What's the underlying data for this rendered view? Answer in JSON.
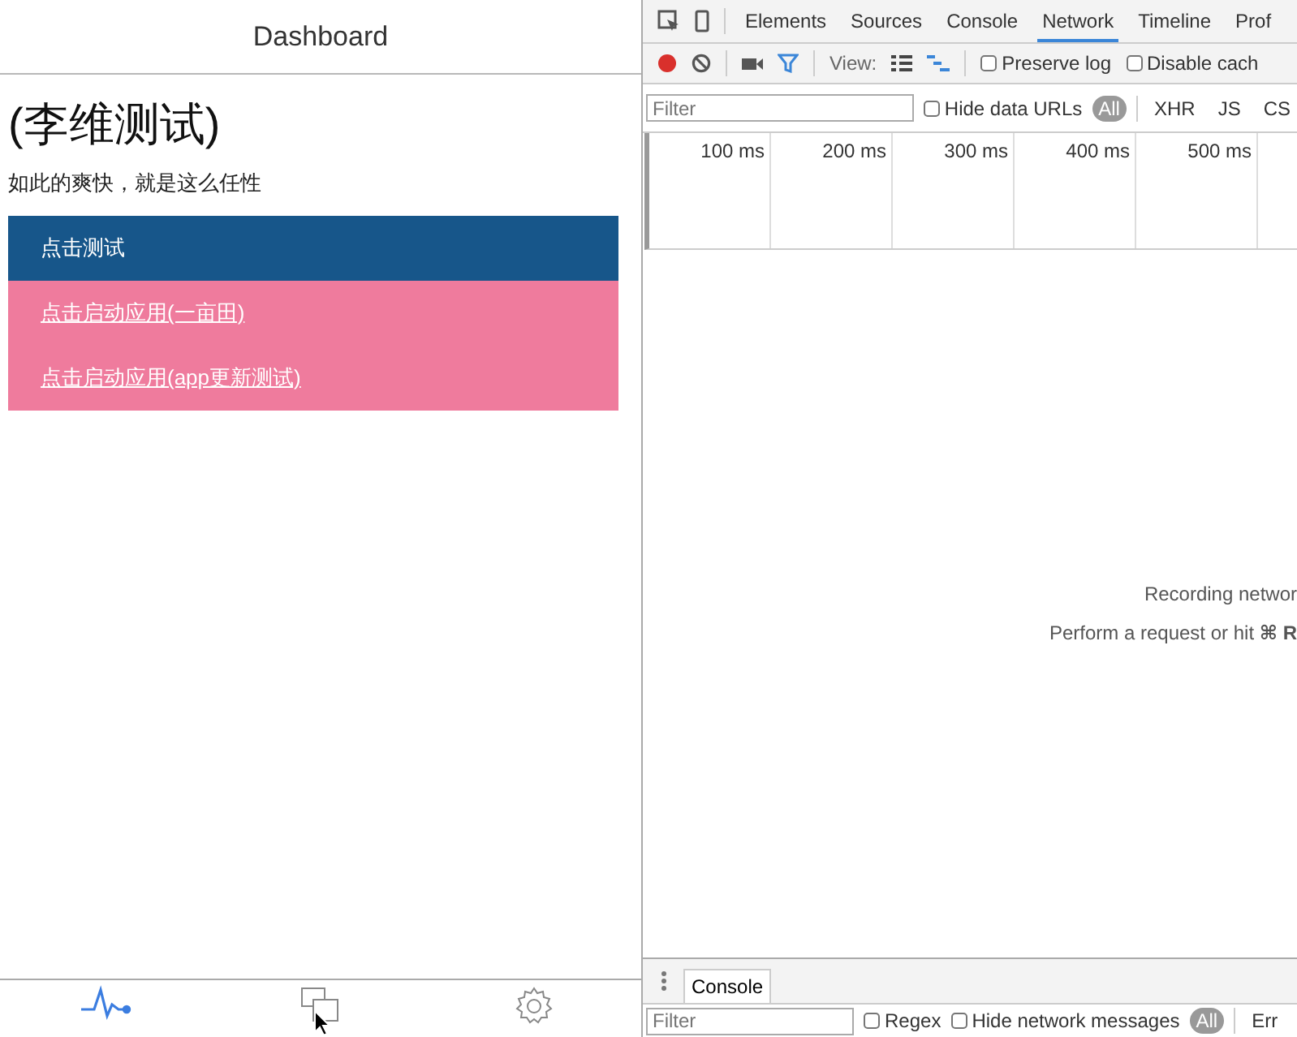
{
  "app": {
    "title": "Dashboard",
    "heading": "(李维测试)",
    "subtitle": "如此的爽快，就是这么任性",
    "items": [
      {
        "label": "点击测试",
        "kind": "header"
      },
      {
        "label": "点击启动应用(一亩田)",
        "kind": "link"
      },
      {
        "label": "点击启动应用(app更新测试)",
        "kind": "link"
      }
    ],
    "tab_bar": [
      {
        "kind": "pulse",
        "selected": true
      },
      {
        "kind": "windows",
        "selected": false
      },
      {
        "kind": "gear",
        "selected": false
      }
    ]
  },
  "devtools": {
    "tabs": [
      {
        "label": "Elements",
        "selected": false
      },
      {
        "label": "Sources",
        "selected": false
      },
      {
        "label": "Console",
        "selected": false
      },
      {
        "label": "Network",
        "selected": true
      },
      {
        "label": "Timeline",
        "selected": false
      },
      {
        "label": "Prof",
        "selected": false
      }
    ],
    "toolbar": {
      "recording": true,
      "filter_on": true,
      "view_label": "View:",
      "options": [
        {
          "label": "Preserve log",
          "checked": false
        },
        {
          "label": "Disable cach",
          "checked": false
        }
      ]
    },
    "filter_bar": {
      "placeholder": "Filter",
      "option": {
        "label": "Hide data URLs",
        "checked": false
      },
      "types": [
        {
          "label": "All",
          "selected": true
        },
        {
          "label": "XHR",
          "selected": false
        },
        {
          "label": "JS",
          "selected": false
        },
        {
          "label": "CS",
          "selected": false
        }
      ]
    },
    "timeline_ticks": [
      "100 ms",
      "200 ms",
      "300 ms",
      "400 ms",
      "500 ms"
    ],
    "empty_message": [
      "Recording networ",
      "Perform a request or hit **⌘ R**"
    ],
    "drawer": {
      "tabs": [
        {
          "label": "Console",
          "selected": true
        }
      ],
      "placeholder": "Filter",
      "options": [
        {
          "label": "Regex",
          "checked": false
        },
        {
          "label": "Hide network messages",
          "checked": false
        }
      ],
      "levels": [
        {
          "label": "All",
          "selected": true
        },
        {
          "label": "Err",
          "selected": false
        }
      ]
    }
  }
}
